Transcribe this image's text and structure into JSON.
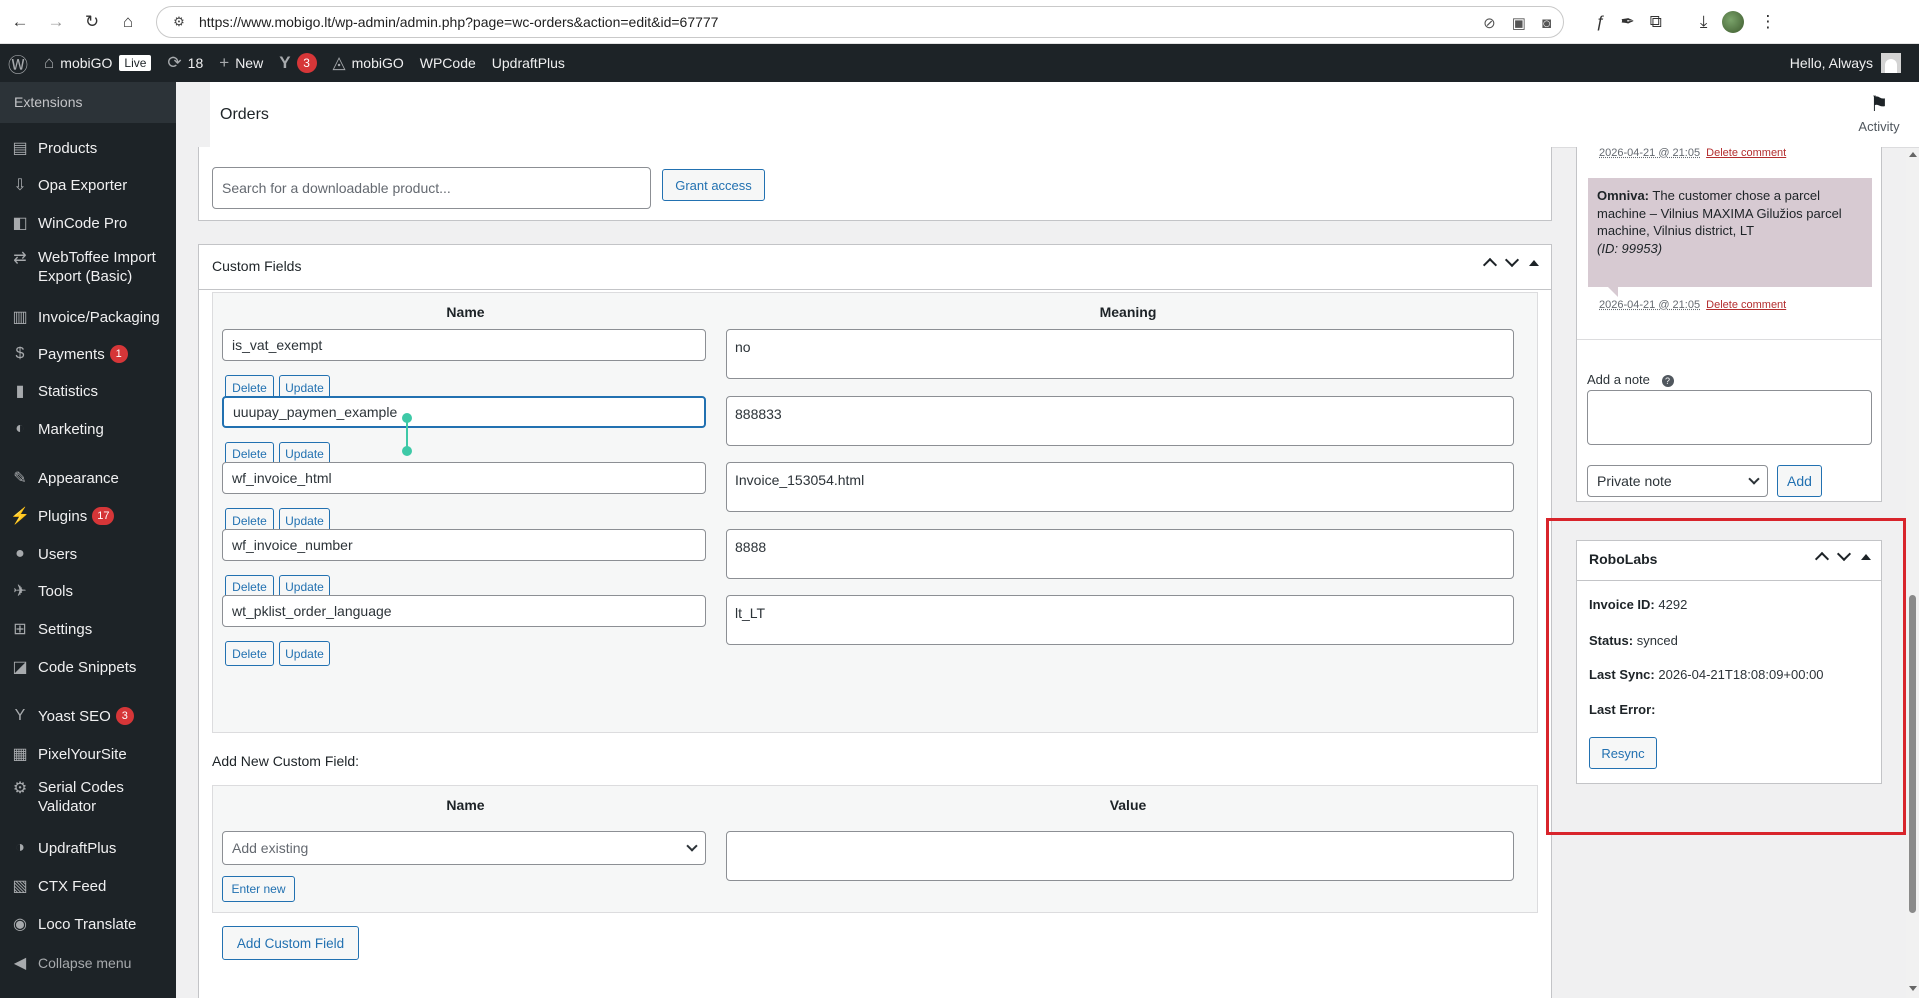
{
  "browser": {
    "url": "https://www.mobigo.lt/wp-admin/admin.php?page=wc-orders&action=edit&id=67777"
  },
  "adminbar": {
    "site_name": "mobiGO",
    "live_badge": "Live",
    "updates_count": "18",
    "new_label": "New",
    "yoast_count": "3",
    "mobigo_label": "mobiGO",
    "wpcode_label": "WPCode",
    "updraft_label": "UpdraftPlus",
    "greeting": "Hello, Always"
  },
  "sidebar": {
    "header": "Extensions",
    "items": [
      {
        "label": "Products",
        "icon": "products-icon",
        "glyph": "▤"
      },
      {
        "label": "Opa Exporter",
        "icon": "exporter-icon",
        "glyph": "⇩"
      },
      {
        "label": "WinCode Pro",
        "icon": "wincode-icon",
        "glyph": "◧"
      },
      {
        "label": "WebToffee Import Export (Basic)",
        "icon": "import-export-icon",
        "glyph": "⇄"
      },
      {
        "label": "Invoice/Packaging",
        "icon": "invoice-icon",
        "glyph": "▥"
      },
      {
        "label": "Payments",
        "icon": "payments-icon",
        "glyph": "$",
        "badge": "1"
      },
      {
        "label": "Statistics",
        "icon": "statistics-icon",
        "glyph": "▮"
      },
      {
        "label": "Marketing",
        "icon": "marketing-icon",
        "glyph": "◐"
      },
      {
        "label": "Appearance",
        "icon": "appearance-icon",
        "glyph": "✎"
      },
      {
        "label": "Plugins",
        "icon": "plugins-icon",
        "glyph": "⚡",
        "badge": "17"
      },
      {
        "label": "Users",
        "icon": "users-icon",
        "glyph": "●"
      },
      {
        "label": "Tools",
        "icon": "tools-icon",
        "glyph": "✈"
      },
      {
        "label": "Settings",
        "icon": "settings-icon",
        "glyph": "⊞"
      },
      {
        "label": "Code Snippets",
        "icon": "code-snippets-icon",
        "glyph": "◪"
      },
      {
        "label": "Yoast SEO",
        "icon": "yoast-icon",
        "glyph": "Y",
        "badge": "3"
      },
      {
        "label": "PixelYourSite",
        "icon": "pixelyoursite-icon",
        "glyph": "▦"
      },
      {
        "label": "Serial Codes Validator",
        "icon": "gear-icon",
        "glyph": "⚙"
      },
      {
        "label": "UpdraftPlus",
        "icon": "updraftplus-icon",
        "glyph": "◑"
      },
      {
        "label": "CTX Feed",
        "icon": "ctx-feed-icon",
        "glyph": "▧"
      },
      {
        "label": "Loco Translate",
        "icon": "loco-icon",
        "glyph": "◉"
      }
    ],
    "collapse_label": "Collapse menu"
  },
  "header": {
    "title": "Orders",
    "activity_label": "Activity"
  },
  "downloads": {
    "search_placeholder": "Search for a downloadable product...",
    "grant_access": "Grant access"
  },
  "custom_fields": {
    "title": "Custom Fields",
    "col_name": "Name",
    "col_meaning": "Meaning",
    "delete_label": "Delete",
    "update_label": "Update",
    "rows": [
      {
        "name": "is_vat_exempt",
        "value": "no"
      },
      {
        "name": "uuupay_paymen_example",
        "value": "888833"
      },
      {
        "name": "wf_invoice_html",
        "value": "Invoice_153054.html"
      },
      {
        "name": "wf_invoice_number",
        "value": "8888"
      },
      {
        "name": "wt_pklist_order_language",
        "value": "lt_LT"
      }
    ],
    "add_new_label": "Add New Custom Field:",
    "new_col_name": "Name",
    "new_col_value": "Value",
    "add_existing": "Add existing",
    "enter_new": "Enter new",
    "add_custom_field": "Add Custom Field"
  },
  "notes": {
    "meta1_date": "2026-04-21 @ 21:05",
    "meta1_delete": "Delete comment",
    "note_author": "Omniva:",
    "note_text": "The customer chose a parcel machine – Vilnius MAXIMA Gilužios parcel machine, Vilnius district, LT",
    "note_id": "(ID: 99953)",
    "meta2_date": "2026-04-21 @ 21:05",
    "meta2_delete": "Delete comment",
    "add_note_label": "Add a note",
    "note_type": "Private note",
    "add_button": "Add"
  },
  "robolabs": {
    "title": "RoboLabs",
    "invoice_id_label": "Invoice ID:",
    "invoice_id": "4292",
    "status_label": "Status:",
    "status": "synced",
    "last_sync_label": "Last Sync:",
    "last_sync": "2026-04-21T18:08:09+00:00",
    "last_error_label": "Last Error:",
    "resync": "Resync"
  },
  "colors": {
    "accent": "#2271b1",
    "admin_bar": "#1d2327",
    "highlight_frame": "#d8242b",
    "note_bg": "#d7cad2"
  }
}
